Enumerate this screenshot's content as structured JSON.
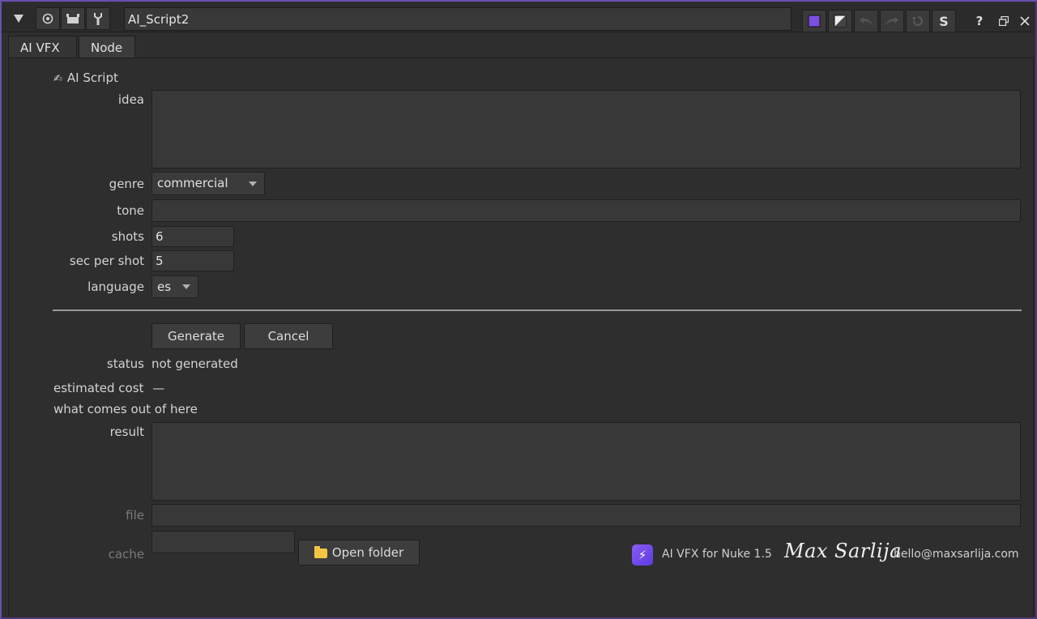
{
  "window": {
    "node_name": "AI_Script2",
    "color_swatch": "#7b4fe0"
  },
  "tabs": [
    {
      "label": "AI VFX"
    },
    {
      "label": "Node"
    }
  ],
  "section": {
    "icon": "pencil-hand-icon",
    "title": "AI Script"
  },
  "form": {
    "idea_label": "idea",
    "idea_value": "",
    "genre_label": "genre",
    "genre_value": "commercial",
    "tone_label": "tone",
    "tone_value": "",
    "shots_label": "shots",
    "shots_value": "6",
    "sec_label": "sec per shot",
    "sec_value": "5",
    "language_label": "language",
    "language_value": "es"
  },
  "actions": {
    "generate": "Generate",
    "cancel": "Cancel"
  },
  "status": {
    "label": "status",
    "value": "not generated",
    "cost_label": "estimated cost",
    "cost_value": "—",
    "output_caption": "what comes out of here"
  },
  "output": {
    "result_label": "result",
    "result_value": "",
    "file_label": "file",
    "file_value": "",
    "cache_label": "cache",
    "cache_value": "",
    "open_folder": "Open folder"
  },
  "footer": {
    "product": "AI VFX for Nuke 1.5",
    "signature": "Max Sarlija",
    "email": "hello@maxsarlija.com"
  }
}
